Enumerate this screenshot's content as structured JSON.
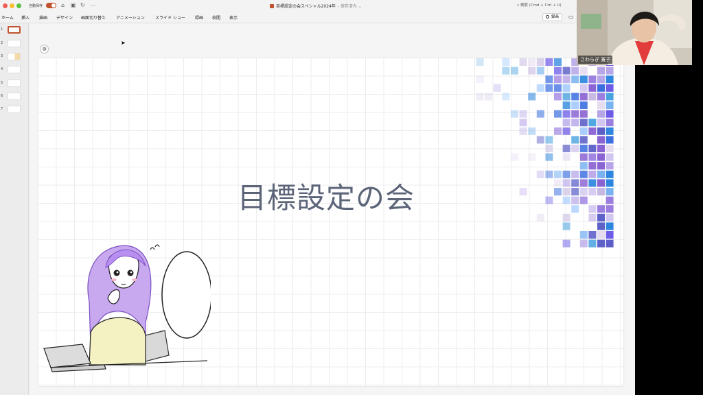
{
  "titlebar": {
    "autosave_label": "自動保存",
    "doc_title": "目標設定の会スペシャル2024年",
    "saved_status": "- 保存済み ⌄",
    "search_placeholder": "検索 (Cmd + Ctrl + U)"
  },
  "ribbon": {
    "tabs": [
      "ホーム",
      "挿入",
      "描画",
      "デザイン",
      "画面切り替え",
      "アニメーション",
      "スライド ショー",
      "録画",
      "校閲",
      "表示"
    ],
    "record_label": "録画"
  },
  "thumbnails": {
    "numbers": [
      "1",
      "2",
      "3",
      "4",
      "5",
      "6",
      "7"
    ],
    "active_index": 1
  },
  "slide": {
    "title": "目標設定の会"
  },
  "video": {
    "participant_name": "さわらぎ 寛子"
  },
  "colors": {
    "accent": "#c0532f",
    "title_text": "#5c6478",
    "mosaic_palette": [
      "#3b6fe0",
      "#5b5fc7",
      "#6c5ce7",
      "#8a63d2",
      "#9b7fe0",
      "#b6a6e8",
      "#d2c7f0",
      "#c6b8e0",
      "#e6dcf0",
      "#7ab3f0",
      "#9ec7ff",
      "#4aa3df",
      "#2e86de"
    ]
  },
  "icons": {
    "home": "house-icon",
    "save": "save-icon",
    "undo": "undo-icon",
    "more": "more-icon",
    "search": "magnifier-icon",
    "comment": "comment-icon",
    "designer": "designer-icon"
  }
}
